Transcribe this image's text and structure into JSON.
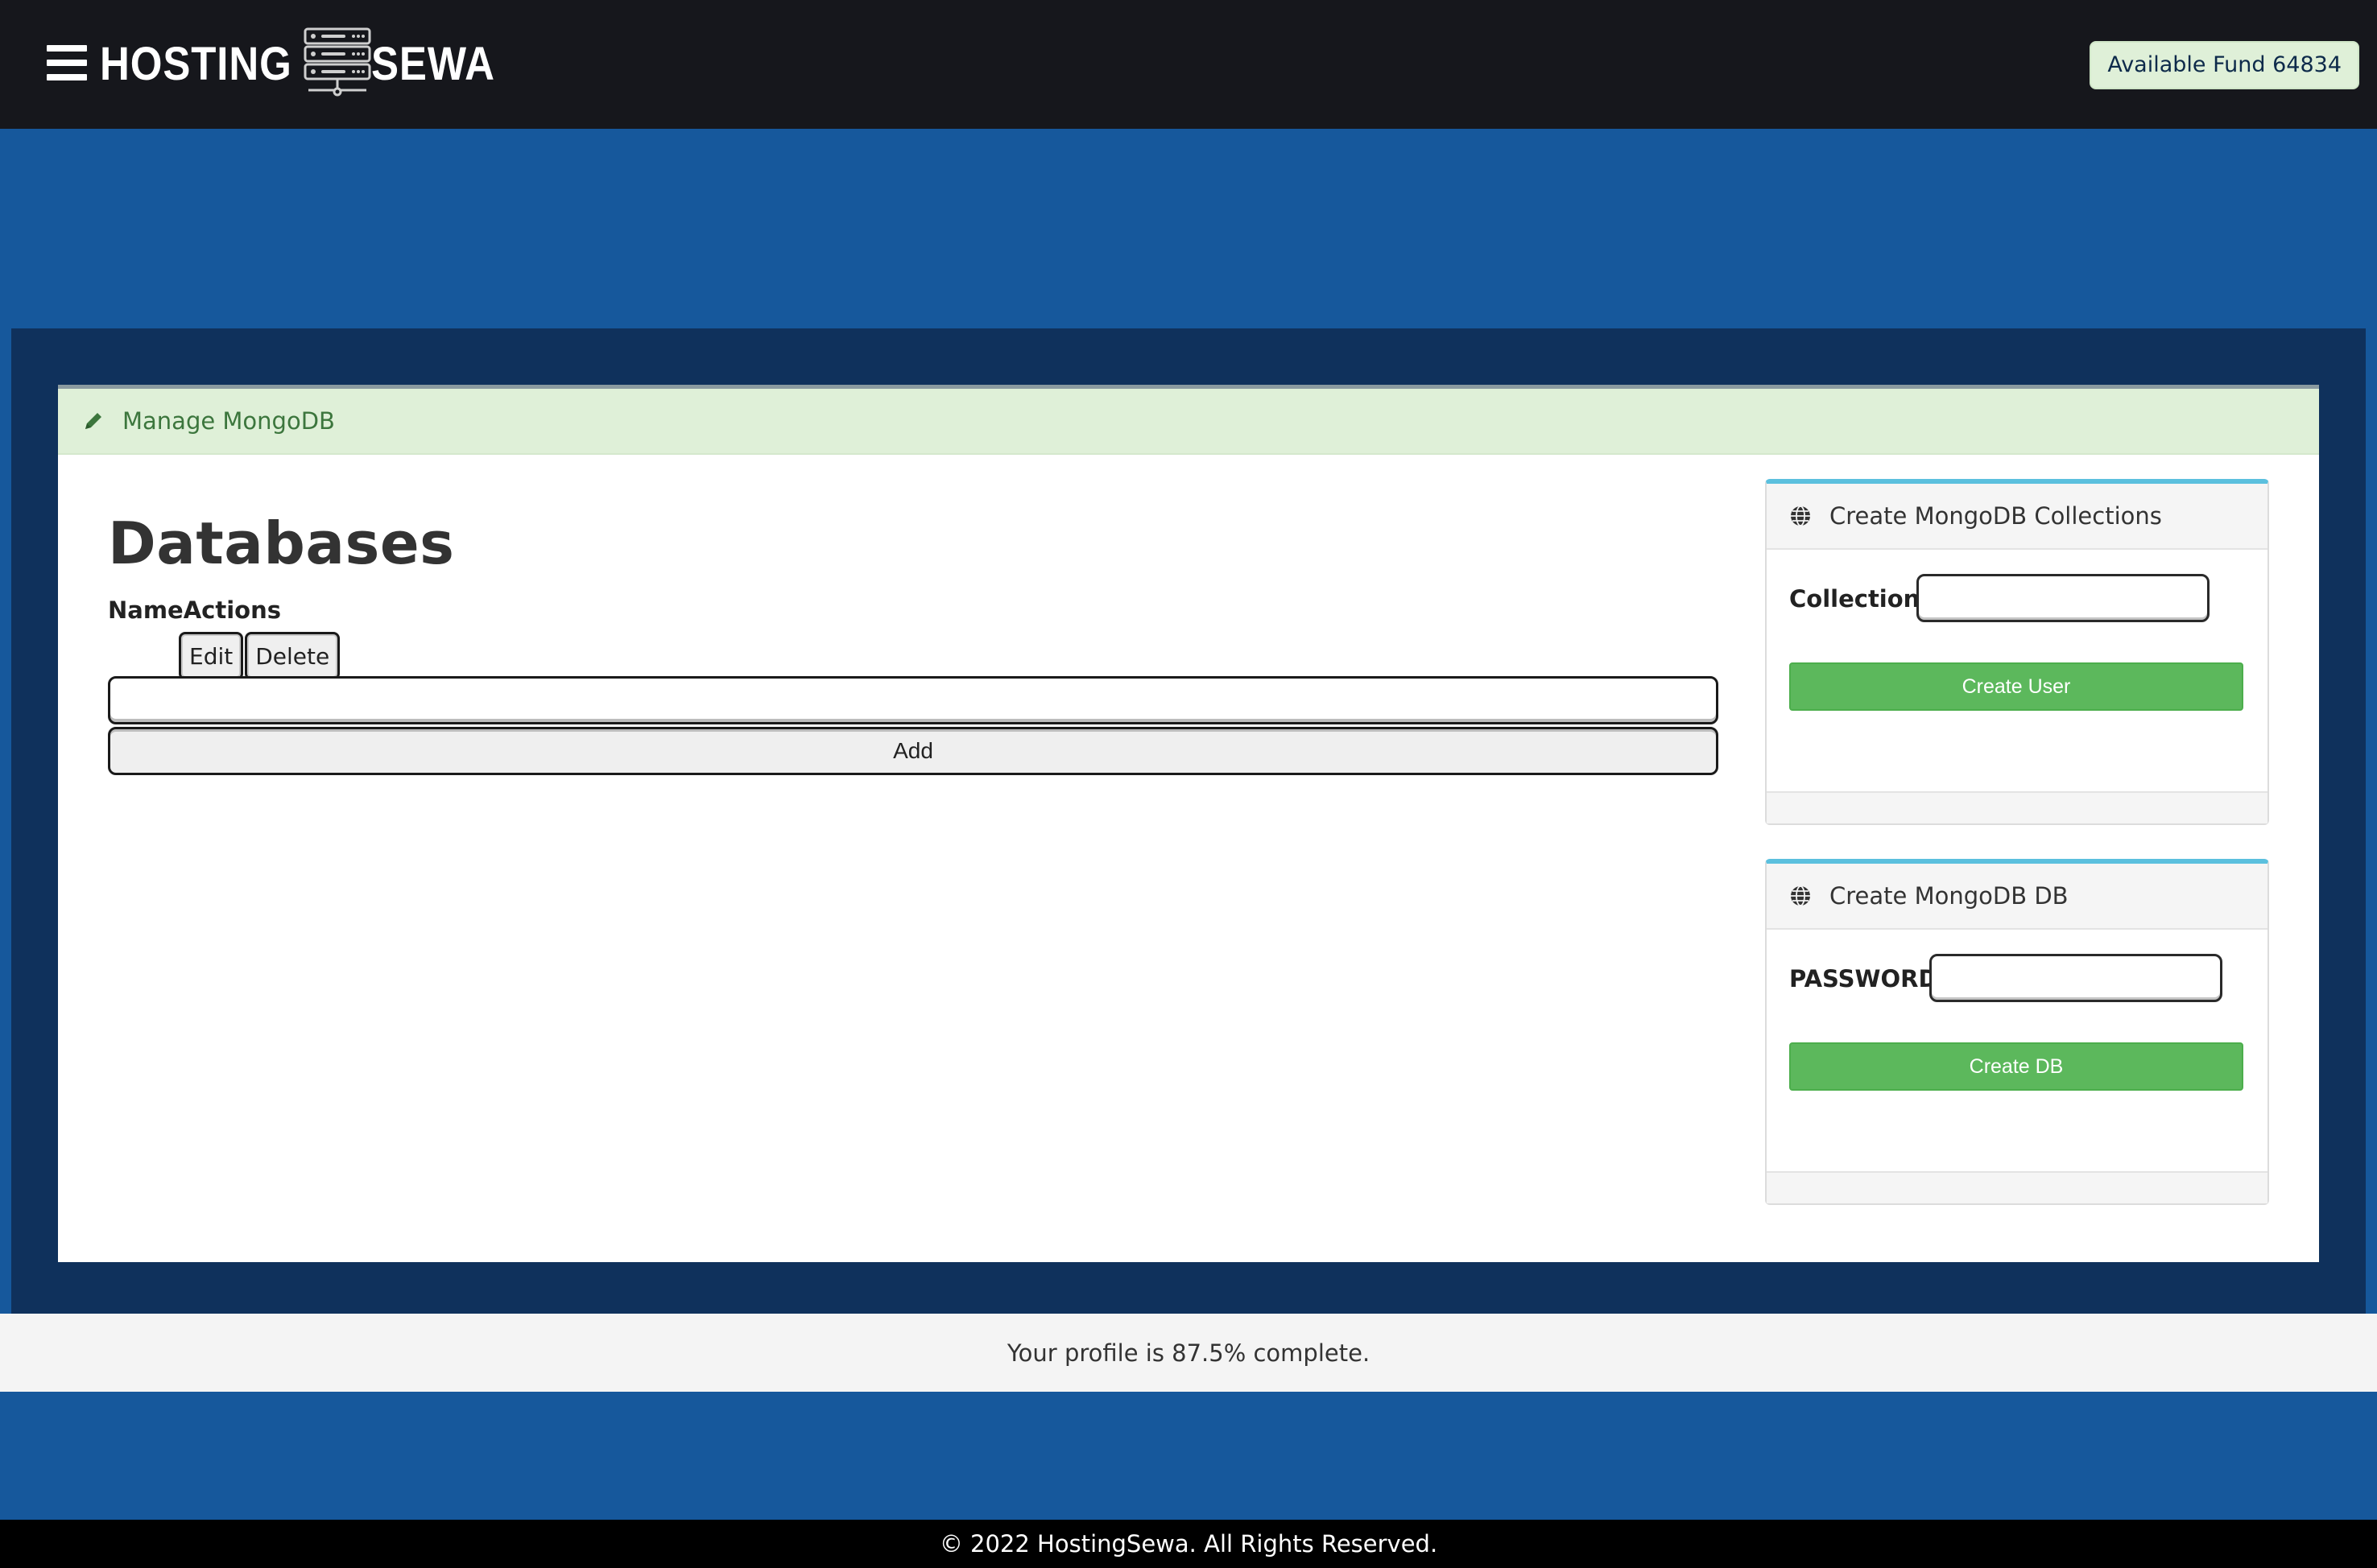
{
  "brand": {
    "name_part1": "HOSTING",
    "name_part2": "SEWA"
  },
  "header": {
    "fund_badge": "Available Fund 64834"
  },
  "panel": {
    "heading": "Manage MongoDB"
  },
  "databases": {
    "title": "Databases",
    "columns": [
      "Name",
      "Actions"
    ],
    "edit_label": "Edit",
    "delete_label": "Delete",
    "new_db_value": "",
    "add_label": "Add"
  },
  "collections_card": {
    "title": "Create MongoDB Collections",
    "field_label": "Collection:",
    "field_value": "",
    "button_label": "Create User"
  },
  "db_card": {
    "title": "Create MongoDB DB",
    "field_label": "PASSWORD:",
    "field_value": "",
    "button_label": "Create DB"
  },
  "profile": {
    "completion_text": "Your profile is 87.5% complete."
  },
  "footer": {
    "copyright": "© 2022 HostingSewa. All Rights Reserved."
  },
  "icons": [
    "menu-icon",
    "server-logo-icon",
    "pencil-icon",
    "globe-icon"
  ],
  "colors": {
    "navbar": "#16171c",
    "page_blue": "#16589c",
    "dark_wrapper": "#0f315c",
    "success_bg": "#dff0d8",
    "success_text": "#3c763d",
    "green_button": "#5cb85c",
    "info_border": "#5bc0de"
  }
}
